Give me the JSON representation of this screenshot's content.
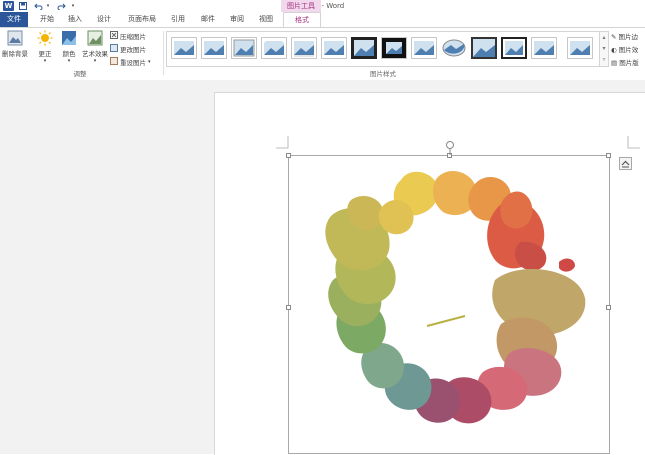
{
  "window": {
    "title": "文档1 - Word",
    "app_icon_letter": "W"
  },
  "context_tab_header": "图片工具",
  "tabs": [
    {
      "label": "文件"
    },
    {
      "label": "开始"
    },
    {
      "label": "插入"
    },
    {
      "label": "设计"
    },
    {
      "label": "页面布局"
    },
    {
      "label": "引用"
    },
    {
      "label": "邮件"
    },
    {
      "label": "审阅"
    },
    {
      "label": "视图"
    },
    {
      "label": "格式"
    }
  ],
  "ribbon": {
    "remove_bg": "删除背景",
    "corrections": "更正",
    "color": "颜色",
    "artistic": "艺术效果",
    "compress": "压缩图片",
    "change": "更改图片",
    "reset": "重设图片",
    "adjust_group": "调整",
    "styles_group": "图片样式",
    "border": "图片边",
    "effects": "图片效",
    "layout": "图片版"
  },
  "colors": {
    "accent": "#2b579a",
    "context": "#a0307d"
  }
}
